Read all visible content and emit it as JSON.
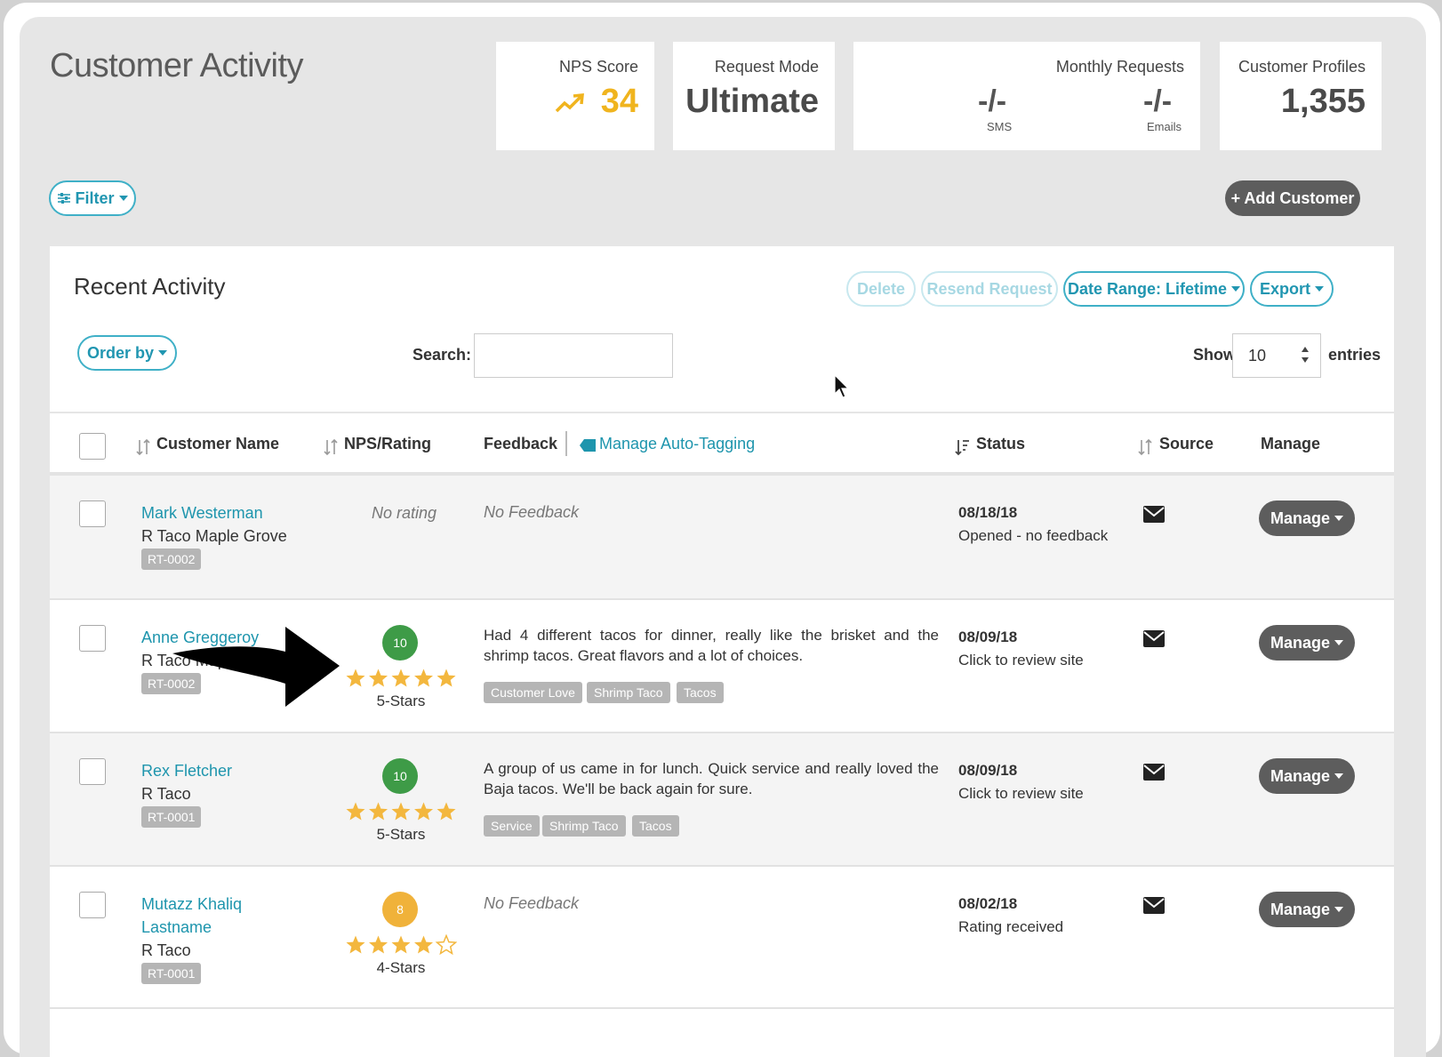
{
  "header": {
    "title": "Customer Activity",
    "nps": {
      "label": "NPS Score",
      "value": "34"
    },
    "request_mode": {
      "label": "Request Mode",
      "value": "Ultimate"
    },
    "monthly_requests": {
      "label": "Monthly Requests",
      "sms_value": "-/-",
      "sms_label": "SMS",
      "email_value": "-/-",
      "email_label": "Emails"
    },
    "customer_profiles": {
      "label": "Customer Profiles",
      "value": "1,355"
    }
  },
  "toolbar": {
    "filter_label": "Filter",
    "add_customer_label": "+ Add Customer"
  },
  "panel": {
    "title": "Recent Activity",
    "delete_label": "Delete",
    "resend_label": "Resend Request",
    "date_range_label": "Date Range: Lifetime",
    "export_label": "Export",
    "order_by_label": "Order by",
    "search_label": "Search:",
    "search_value": "",
    "show_label": "Show",
    "entries_value": "10",
    "entries_label": "entries"
  },
  "table": {
    "columns": {
      "customer_name": "Customer Name",
      "nps_rating": "NPS/Rating",
      "feedback": "Feedback",
      "auto_tagging": "Manage Auto-Tagging",
      "status": "Status",
      "source": "Source",
      "manage": "Manage"
    },
    "rows": [
      {
        "name": "Mark Westerman",
        "location": "R Taco Maple Grove",
        "code": "RT-0002",
        "rating_text": "No rating",
        "feedback": "No Feedback",
        "tags": [],
        "date": "08/18/18",
        "status": "Opened - no feedback",
        "manage_label": "Manage"
      },
      {
        "name": "Anne Greggeroy",
        "location": "R Taco Maple Grove",
        "code": "RT-0002",
        "nps": "10",
        "stars": 5,
        "stars_label": "5-Stars",
        "feedback": "Had 4 different tacos for dinner, really like the brisket and the shrimp tacos. Great flavors and a lot of choices.",
        "tags": [
          "Customer Love",
          "Shrimp Taco",
          "Tacos"
        ],
        "date": "08/09/18",
        "status": "Click to review site",
        "manage_label": "Manage"
      },
      {
        "name": "Rex Fletcher",
        "location": "R Taco",
        "code": "RT-0001",
        "nps": "10",
        "stars": 5,
        "stars_label": "5-Stars",
        "feedback": "A group of us came in for lunch. Quick service and really loved the Baja tacos. We'll be back again for sure.",
        "tags": [
          "Service",
          "Shrimp Taco",
          "Tacos"
        ],
        "date": "08/09/18",
        "status": "Click to review site",
        "manage_label": "Manage"
      },
      {
        "name_line1": "Mutazz Khaliq",
        "name_line2": "Lastname",
        "location": "R Taco",
        "code": "RT-0001",
        "nps": "8",
        "stars": 4,
        "stars_label": "4-Stars",
        "feedback": "No Feedback",
        "tags": [],
        "date": "08/02/18",
        "status": "Rating received",
        "manage_label": "Manage"
      }
    ]
  },
  "colors": {
    "teal": "#1e95ad",
    "nps_yellow": "#f0b41e",
    "promoter_green": "#3e9b47",
    "passive_orange": "#f0b23a",
    "star": "#f3b73e",
    "dark_button": "#5d5d5d"
  },
  "icons": [
    "filter-icon",
    "trend-up-icon",
    "sort-icon",
    "tag-icon",
    "mail-icon",
    "caret-down-icon",
    "star-icon",
    "arrow-annotation",
    "mouse-cursor"
  ]
}
